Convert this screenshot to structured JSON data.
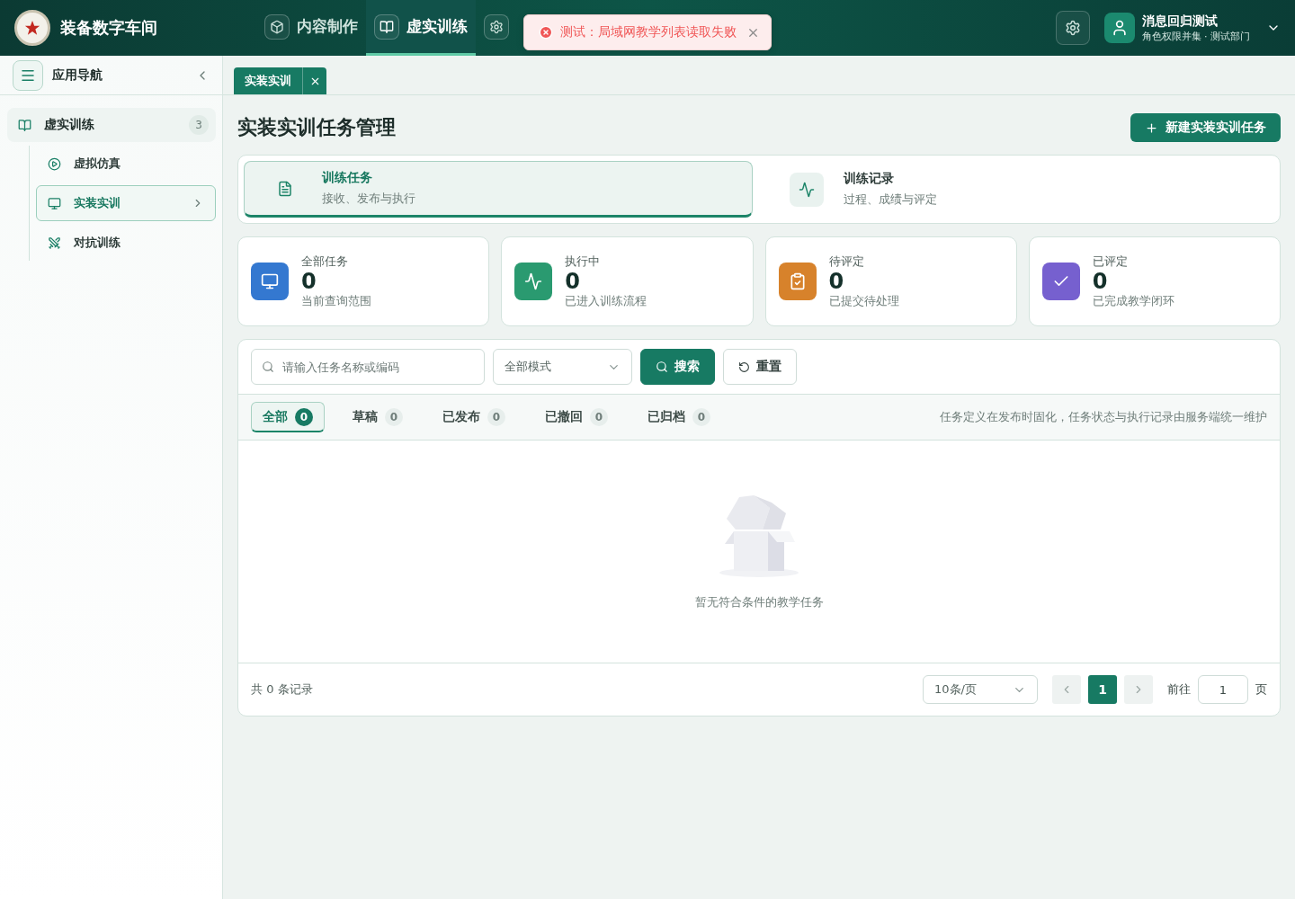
{
  "app": {
    "title": "装备数字车间"
  },
  "top_nav": [
    {
      "label": "内容制作",
      "selected": false
    },
    {
      "label": "虚实训练",
      "selected": true
    },
    {
      "selected": false
    }
  ],
  "toast": {
    "kind": "error",
    "message": "测试：局域网教学列表读取失败"
  },
  "user": {
    "name": "消息回归测试",
    "subtitle": "角色权限并集 · 测试部门"
  },
  "sidebar": {
    "title": "应用导航",
    "group": {
      "label": "虚实训练",
      "count": "3",
      "children": [
        {
          "label": "虚拟仿真",
          "selected": false
        },
        {
          "label": "实装实训",
          "selected": true
        },
        {
          "label": "对抗训练",
          "selected": false
        }
      ]
    }
  },
  "page_tabs": [
    {
      "label": "实装实训",
      "selected": true
    }
  ],
  "page": {
    "title": "实装实训任务管理",
    "create_button": "新建实装实训任务"
  },
  "views": [
    {
      "title": "训练任务",
      "subtitle": "接收、发布与执行",
      "selected": true
    },
    {
      "title": "训练记录",
      "subtitle": "过程、成绩与评定",
      "selected": false
    }
  ],
  "stats": [
    {
      "label": "全部任务",
      "value": "0",
      "note": "当前查询范围",
      "color": "#3478d0"
    },
    {
      "label": "执行中",
      "value": "0",
      "note": "已进入训练流程",
      "color": "#2a9a70"
    },
    {
      "label": "待评定",
      "value": "0",
      "note": "已提交待处理",
      "color": "#d7822b"
    },
    {
      "label": "已评定",
      "value": "0",
      "note": "已完成教学闭环",
      "color": "#7660cf"
    }
  ],
  "filters": {
    "search": {
      "placeholder": "请输入任务名称或编码"
    },
    "mode": {
      "value": "全部模式"
    },
    "search_button": "搜索",
    "reset_button": "重置"
  },
  "status_tabs": [
    {
      "label": "全部",
      "count": "0",
      "selected": true
    },
    {
      "label": "草稿",
      "count": "0",
      "selected": false
    },
    {
      "label": "已发布",
      "count": "0",
      "selected": false
    },
    {
      "label": "已撤回",
      "count": "0",
      "selected": false
    },
    {
      "label": "已归档",
      "count": "0",
      "selected": false
    }
  ],
  "status_note": "任务定义在发布时固化，任务状态与执行记录由服务端统一维护",
  "empty": {
    "message": "暂无符合条件的教学任务"
  },
  "pagination": {
    "total": "共 0 条记录",
    "page_size": "10条/页",
    "pages": [
      {
        "label": "1",
        "selected": true
      }
    ],
    "goto_label": "前往",
    "goto_value": "1",
    "page_unit": "页"
  }
}
